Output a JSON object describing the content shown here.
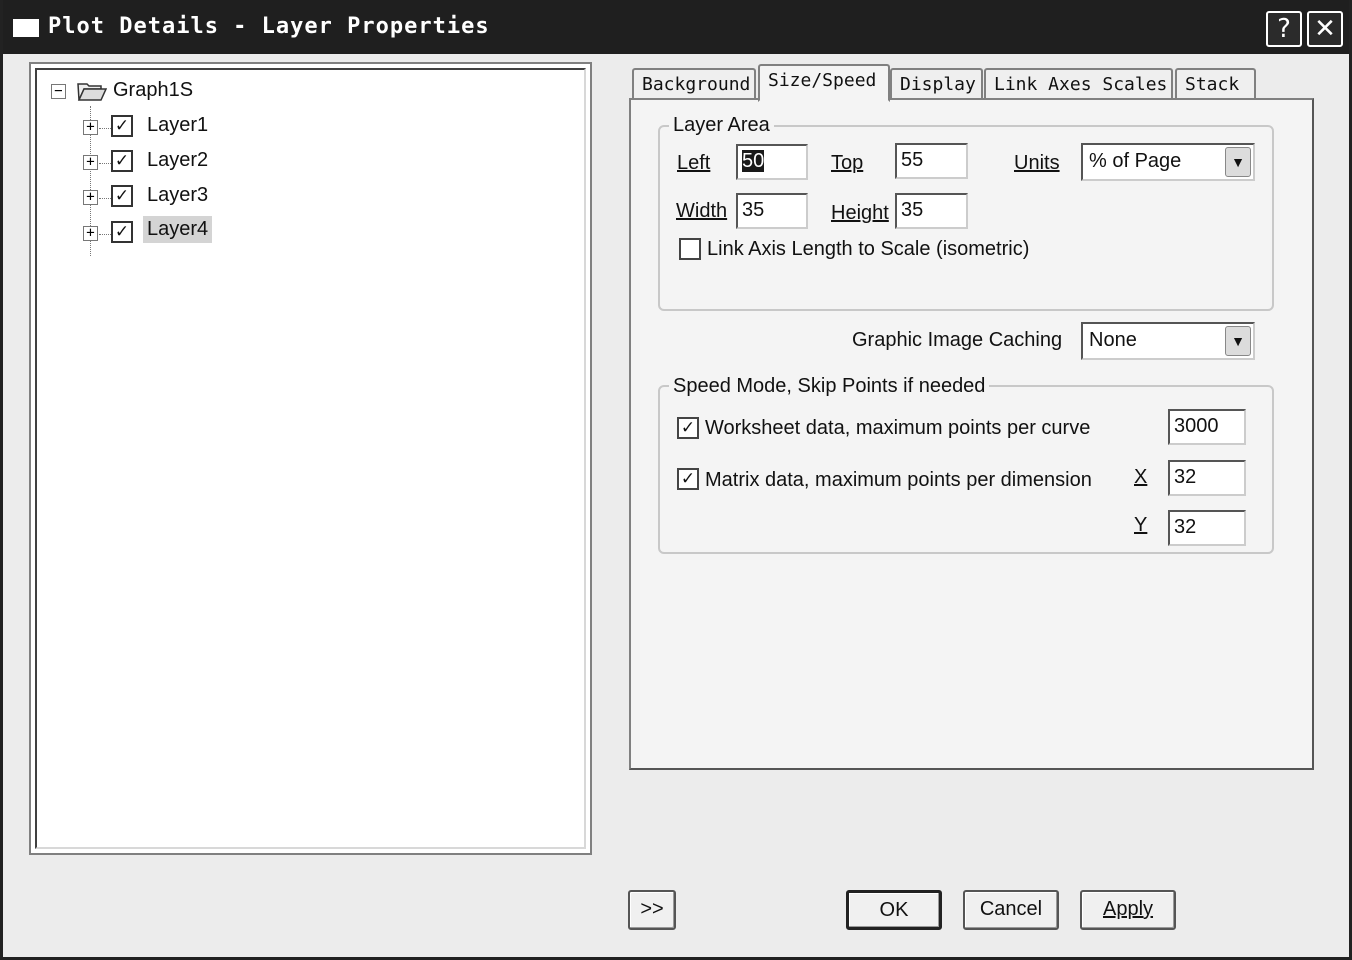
{
  "window": {
    "title": "Plot Details - Layer Properties",
    "help_glyph": "?",
    "close_glyph": "✕"
  },
  "tree": {
    "root": {
      "label": "Graph1S",
      "expander": "−"
    },
    "layers": [
      {
        "label": "Layer1",
        "expander": "+",
        "checked": true
      },
      {
        "label": "Layer2",
        "expander": "+",
        "checked": true
      },
      {
        "label": "Layer3",
        "expander": "+",
        "checked": true
      },
      {
        "label": "Layer4",
        "expander": "+",
        "checked": true,
        "selected": true
      }
    ],
    "check_glyph": "✓"
  },
  "tabs": [
    {
      "label": "Background"
    },
    {
      "label": "Size/Speed",
      "active": true
    },
    {
      "label": "Display"
    },
    {
      "label": "Link Axes Scales"
    },
    {
      "label": "Stack"
    }
  ],
  "layer_area": {
    "title": "Layer Area",
    "left_label": "Left",
    "left_value": "50",
    "top_label": "Top",
    "top_value": "55",
    "units_label": "Units",
    "units_value": "% of Page",
    "width_label": "Width",
    "width_value": "35",
    "height_label": "Height",
    "height_value": "35",
    "link_axis_label": "Link Axis Length to Scale (isometric)",
    "link_axis_checked": false
  },
  "caching": {
    "label": "Graphic Image Caching",
    "value": "None"
  },
  "speed_mode": {
    "title": "Speed Mode, Skip Points if needed",
    "worksheet_label": "Worksheet data, maximum points per curve",
    "worksheet_checked": true,
    "worksheet_value": "3000",
    "matrix_label": "Matrix data, maximum points per dimension",
    "matrix_checked": true,
    "x_label": "X",
    "x_value": "32",
    "y_label": "Y",
    "y_value": "32"
  },
  "buttons": {
    "expand": ">>",
    "ok": "OK",
    "cancel": "Cancel",
    "apply": "Apply"
  },
  "combo_arrow_glyph": "▼"
}
